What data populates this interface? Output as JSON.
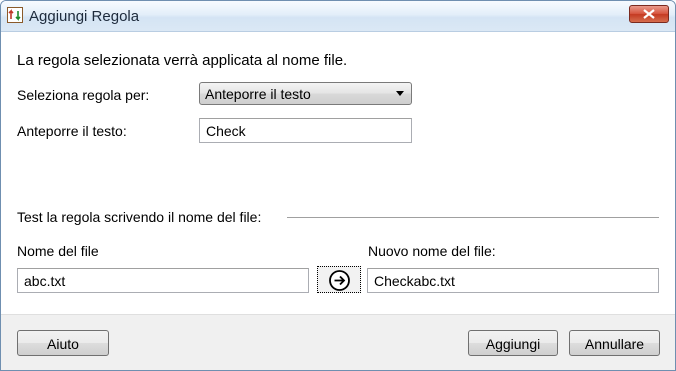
{
  "window": {
    "title": "Aggiungi Regola"
  },
  "description": "La regola selezionata verrà applicata al nome file.",
  "rule": {
    "select_label": "Seleziona regola per:",
    "select_value": "Anteporre il testo",
    "text_label": "Anteporre il testo:",
    "text_value": "Check"
  },
  "test": {
    "section_label": "Test la regola scrivendo il nome del file:",
    "filename_label": "Nome del file",
    "filename_value": "abc.txt",
    "newname_label": "Nuovo nome del file:",
    "newname_value": "Checkabc.txt"
  },
  "buttons": {
    "help": "Aiuto",
    "add": "Aggiungi",
    "cancel": "Annullare"
  },
  "icons": {
    "app": "rename-app-icon",
    "close": "close-icon",
    "arrow": "arrow-right-circle-icon"
  }
}
